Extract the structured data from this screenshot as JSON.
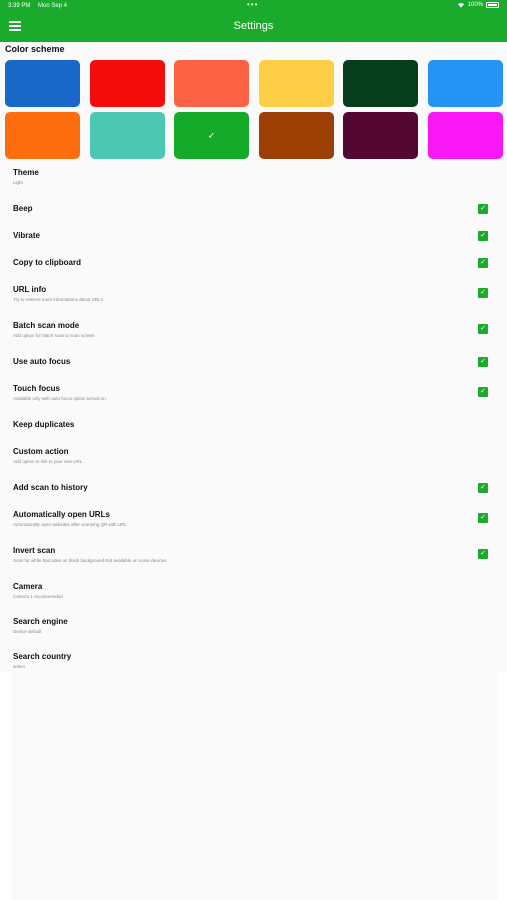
{
  "status_bar": {
    "time": "3:39 PM",
    "date": "Mon Sep 4",
    "dots": "•••",
    "battery": "100%"
  },
  "header": {
    "title": "Settings",
    "menu_icon": "hamburger-menu-icon"
  },
  "colors": {
    "accent": "#1aab2d"
  },
  "color_scheme": {
    "title": "Color scheme",
    "swatches": [
      {
        "color": "#1967c8",
        "selected": false
      },
      {
        "color": "#f50d0d",
        "selected": false
      },
      {
        "color": "#fd6245",
        "selected": false
      },
      {
        "color": "#fecf46",
        "selected": false
      },
      {
        "color": "#063d1d",
        "selected": false
      },
      {
        "color": "#2694f7",
        "selected": false
      },
      {
        "color": "#fd6e0e",
        "selected": false
      },
      {
        "color": "#4cc8b0",
        "selected": false
      },
      {
        "color": "#16aa2b",
        "selected": true,
        "check": "✓"
      },
      {
        "color": "#9b3f05",
        "selected": false
      },
      {
        "color": "#530731",
        "selected": false
      },
      {
        "color": "#fa17f5",
        "selected": false
      }
    ]
  },
  "settings": [
    {
      "label": "Theme",
      "subtitle": "Light",
      "checked": false
    },
    {
      "label": "Beep",
      "subtitle": "",
      "checked": true
    },
    {
      "label": "Vibrate",
      "subtitle": "",
      "checked": true
    },
    {
      "label": "Copy to clipboard",
      "subtitle": "",
      "checked": true
    },
    {
      "label": "URL info",
      "subtitle": "Try to retrieve more informations about URLs",
      "checked": true
    },
    {
      "label": "Batch scan mode",
      "subtitle": "Add option for batch scan to scan screen",
      "checked": true
    },
    {
      "label": "Use auto focus",
      "subtitle": "",
      "checked": true
    },
    {
      "label": "Touch focus",
      "subtitle": "Available only with auto focus option turned on",
      "checked": true
    },
    {
      "label": "Keep duplicates",
      "subtitle": "",
      "checked": false
    },
    {
      "label": "Custom action",
      "subtitle": "Add option to link to your own URL",
      "checked": false
    },
    {
      "label": "Add scan to history",
      "subtitle": "",
      "checked": true
    },
    {
      "label": "Automatically open URLs",
      "subtitle": "Automatically open websites after scanning QR with URL",
      "checked": true
    },
    {
      "label": "Invert scan",
      "subtitle": "Scan for white barcodes on black background.Not available on some devices",
      "checked": true
    },
    {
      "label": "Camera",
      "subtitle": "Camera 1 recommended",
      "checked": false
    },
    {
      "label": "Search engine",
      "subtitle": "Device default",
      "checked": false
    },
    {
      "label": "Search country",
      "subtitle": "select",
      "checked": false
    }
  ],
  "checkmark": "✓"
}
